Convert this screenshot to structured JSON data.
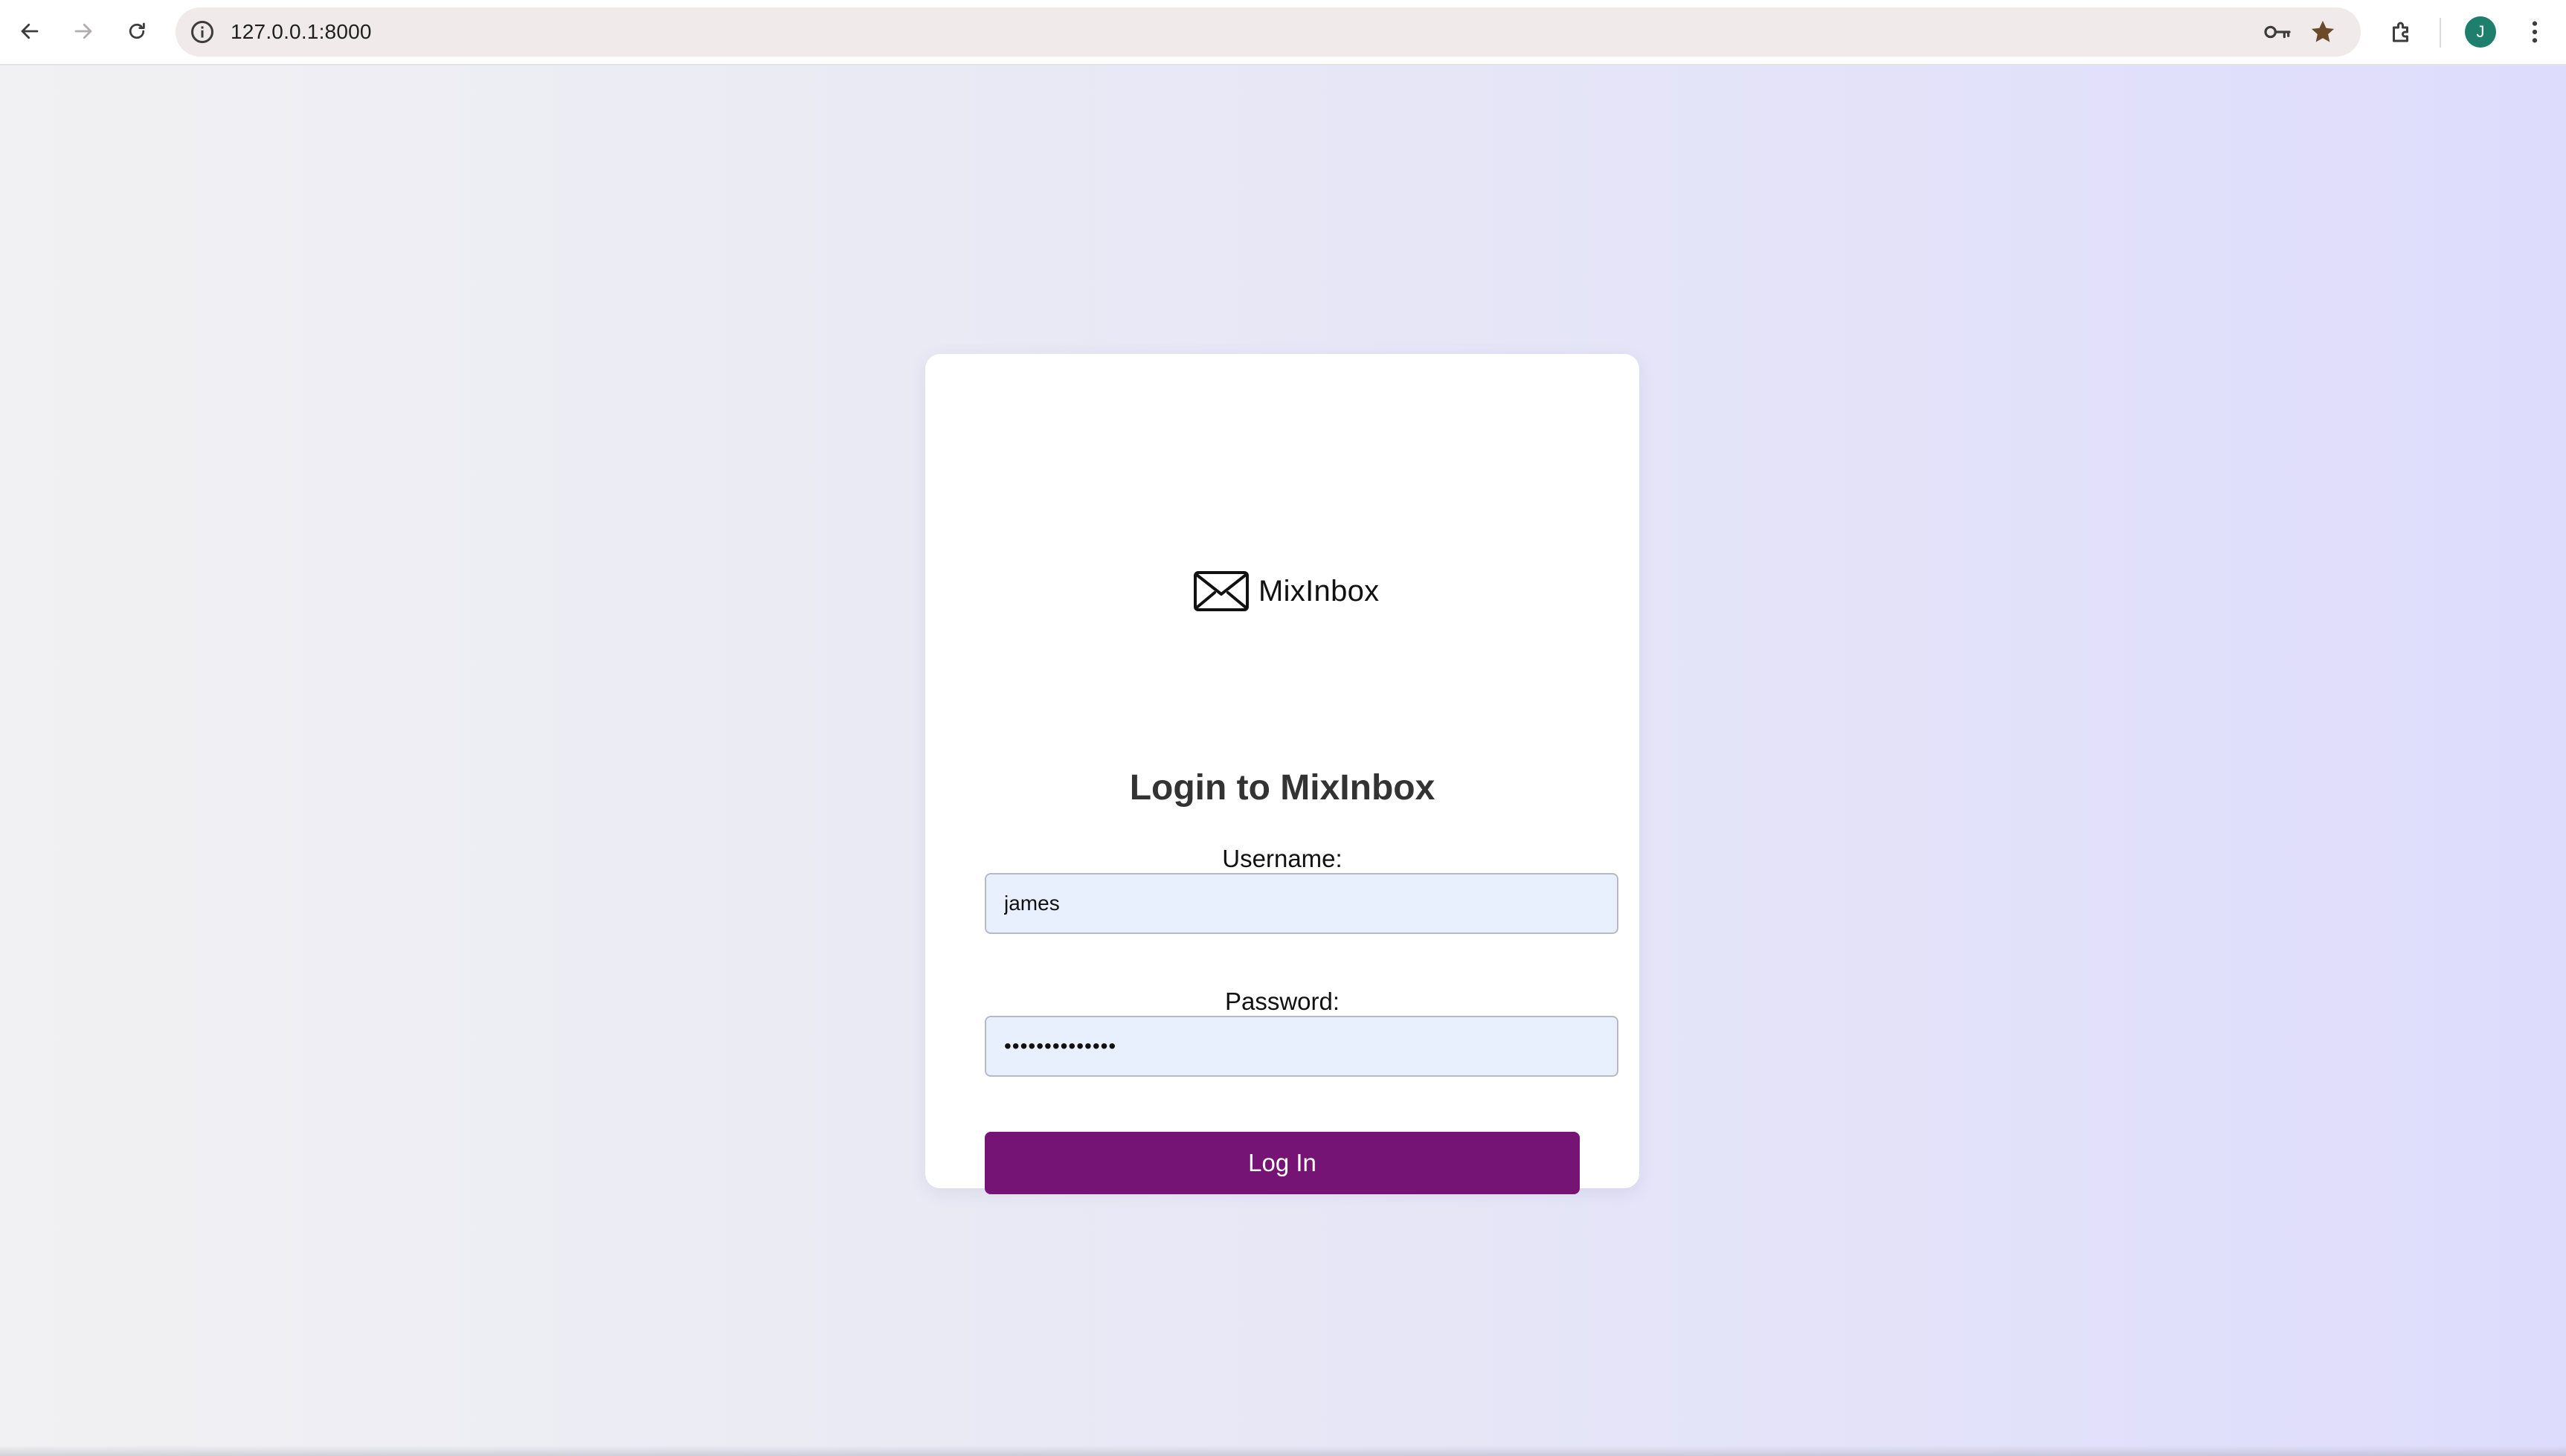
{
  "browser": {
    "url": "127.0.0.1:8000",
    "profile_initial": "J",
    "profile_color": "#1e7f6c",
    "icons": {
      "back": "arrow-left-icon",
      "forward": "arrow-right-icon",
      "reload": "reload-icon",
      "site_info": "info-icon",
      "password_manager": "key-icon",
      "bookmark": "star-icon",
      "extensions": "puzzle-icon",
      "menu": "kebab-menu-icon"
    }
  },
  "login": {
    "brand_name": "MixInbox",
    "logo_icon": "envelope-icon",
    "heading": "Login to MixInbox",
    "username_label": "Username:",
    "username_value": "james",
    "password_label": "Password:",
    "password_value": "••••••••••••••",
    "submit_label": "Log In",
    "accent_color": "#761475"
  }
}
